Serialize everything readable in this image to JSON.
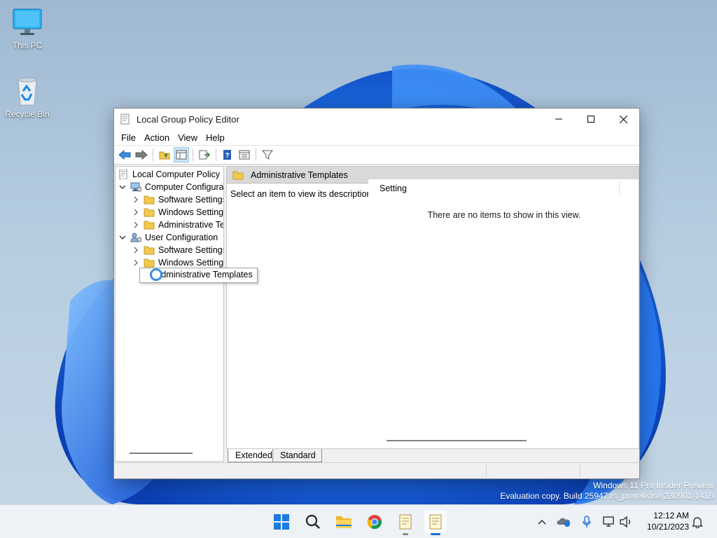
{
  "desktop": {
    "icons": [
      {
        "label": "This PC",
        "icon": "monitor-icon"
      },
      {
        "label": "Recycle Bin",
        "icon": "recycle-bin-icon"
      }
    ],
    "watermark": {
      "line1": "Windows 11 Pro Insider Preview",
      "line2": "Evaluation copy. Build 25947.rs_prerelease.230901-1416"
    }
  },
  "window": {
    "title": "Local Group Policy Editor",
    "menu": [
      "File",
      "Action",
      "View",
      "Help"
    ],
    "toolbar_icons": [
      "back-arrow-icon",
      "forward-arrow-icon",
      "up-folder-icon",
      "show-hide-tree-icon",
      "export-list-icon",
      "help-icon",
      "properties-icon",
      "filter-icon"
    ],
    "tree": [
      {
        "label": "Local Computer Policy",
        "icon": "policy-doc-icon",
        "expander": "none"
      },
      {
        "label": "Computer Configura",
        "icon": "computer-config-icon",
        "expander": "expanded"
      },
      {
        "label": "Software Settings",
        "icon": "folder-icon",
        "expander": "collapsed"
      },
      {
        "label": "Windows Setting",
        "icon": "folder-icon",
        "expander": "collapsed"
      },
      {
        "label": "Administrative Te",
        "icon": "folder-icon",
        "expander": "collapsed"
      },
      {
        "label": "User Configuration",
        "icon": "user-config-icon",
        "expander": "expanded"
      },
      {
        "label": "Software Settings",
        "icon": "folder-icon",
        "expander": "collapsed"
      },
      {
        "label": "Windows Setting",
        "icon": "folder-icon",
        "expander": "collapsed"
      },
      {
        "label": "",
        "icon": "folder-icon",
        "expander": "none"
      }
    ],
    "tooltip": "Administrative Templates",
    "node_header": "Administrative Templates",
    "description": "Select an item to view its description.",
    "list_column": "Setting",
    "empty_message": "There are no items to show in this view.",
    "tabs": [
      "Extended",
      "Standard"
    ]
  },
  "taskbar": {
    "apps": [
      "start-icon",
      "search-icon",
      "file-explorer-icon",
      "chrome-icon",
      "notepad-icon",
      "group-policy-editor-icon"
    ],
    "tray": [
      "chevron-up-icon",
      "onedrive-icon",
      "microphone-icon",
      "network-icon",
      "speaker-icon",
      "notification-bell-icon"
    ],
    "time": "12:12 AM",
    "date": "10/21/2023"
  },
  "colors": {
    "accent": "#1a6fd0",
    "folder": "#f2c94c",
    "wallpaper_bloom": "#1463e0"
  }
}
